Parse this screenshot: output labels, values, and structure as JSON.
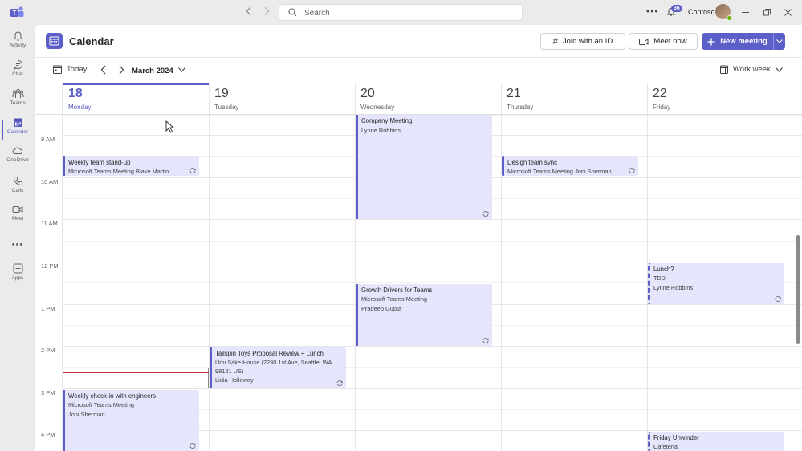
{
  "topbar": {
    "search_placeholder": "Search",
    "notification_count": "36",
    "org_name": "Contoso"
  },
  "rail": [
    {
      "label": "Activity",
      "icon": "bell-icon"
    },
    {
      "label": "Chat",
      "icon": "chat-icon"
    },
    {
      "label": "Teams",
      "icon": "teams-icon"
    },
    {
      "label": "Calendar",
      "icon": "calendar-icon"
    },
    {
      "label": "OneDrive",
      "icon": "cloud-icon"
    },
    {
      "label": "Calls",
      "icon": "phone-icon"
    },
    {
      "label": "Meet",
      "icon": "video-icon"
    },
    {
      "label": "Apps",
      "icon": "add-apps-icon"
    }
  ],
  "header": {
    "title": "Calendar",
    "join_label": "Join with an ID",
    "meet_now_label": "Meet now",
    "new_meeting_label": "New meeting"
  },
  "toolbar": {
    "today_label": "Today",
    "month_label": "March 2024",
    "view_label": "Work week"
  },
  "days": [
    {
      "num": "18",
      "name": "Monday"
    },
    {
      "num": "19",
      "name": "Tuesday"
    },
    {
      "num": "20",
      "name": "Wednesday"
    },
    {
      "num": "21",
      "name": "Thursday"
    },
    {
      "num": "22",
      "name": "Friday"
    }
  ],
  "times": [
    "9 AM",
    "10 AM",
    "11 AM",
    "12 PM",
    "1 PM",
    "2 PM",
    "3 PM",
    "4 PM"
  ],
  "events": {
    "standup": {
      "title": "Weekly team stand-up",
      "line1": "Microsoft Teams Meeting  Blake Martin"
    },
    "company": {
      "title": "Company Meeting",
      "line1": "Lynne Robbins"
    },
    "design": {
      "title": "Design team sync",
      "line1": "Microsoft Teams Meeting  Joni Sherman"
    },
    "lunch": {
      "title": "Lunch?",
      "line1": "TBD",
      "line2": "Lynne Robbins"
    },
    "growth": {
      "title": "Growth Drivers for Teams",
      "line1": "Microsoft Teams Meeting",
      "line2": "Pradeep Gupta"
    },
    "tailspin": {
      "title": "Tailspin Toys Proposal Review + Lunch",
      "line1": "Umi Sake House (2230 1st Ave, Seattle, WA 98121 US)",
      "line2": "Lidia Holloway"
    },
    "checkin": {
      "title": "Weekly check-in with engineers",
      "line1": "Microsoft Teams Meeting",
      "line2": "Joni Sherman"
    },
    "unwinder": {
      "title": "Friday Unwinder",
      "line1": "Cafeteria"
    }
  },
  "colors": {
    "accent": "#5b5fc7",
    "event_bg": "#e5e6fb",
    "now_line": "#c4314b"
  }
}
